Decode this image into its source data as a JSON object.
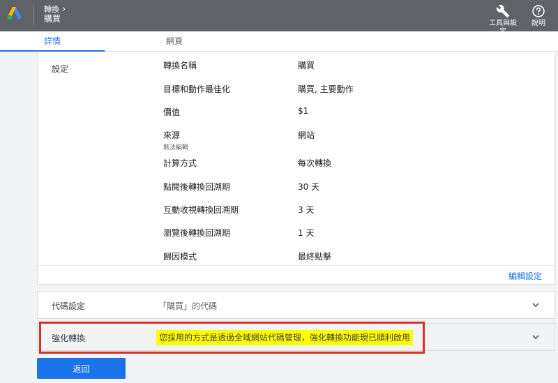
{
  "header": {
    "breadcrumb_parent": "轉換",
    "title": "購買",
    "tools_label": "工具與設定",
    "help_label": "說明",
    "colors": {
      "bar": "#5f6368",
      "logo_blue": "#4285f4",
      "logo_yellow": "#fbbc04",
      "logo_green": "#34a853"
    }
  },
  "tabs": [
    {
      "label": "詳情",
      "active": true
    },
    {
      "label": "網頁",
      "active": false
    }
  ],
  "settings": {
    "section_label": "設定",
    "rows": [
      {
        "label": "轉換名稱",
        "sub": "",
        "value": "購買"
      },
      {
        "label": "目標和動作最佳化",
        "sub": "",
        "value": "購買, 主要動作"
      },
      {
        "label": "價值",
        "sub": "",
        "value": "$1"
      },
      {
        "label": "來源",
        "sub": "無法編輯",
        "value": "網站"
      },
      {
        "label": "計算方式",
        "sub": "",
        "value": "每次轉換"
      },
      {
        "label": "點閱後轉換回溯期",
        "sub": "",
        "value": "30 天"
      },
      {
        "label": "互動收視轉換回溯期",
        "sub": "",
        "value": "3 天"
      },
      {
        "label": "瀏覽後轉換回溯期",
        "sub": "",
        "value": "1 天"
      },
      {
        "label": "歸因模式",
        "sub": "",
        "value": "最終點擊"
      }
    ],
    "edit_label": "編輯設定"
  },
  "tag_setup": {
    "label": "代碼設定",
    "value": "「購買」的代碼",
    "icon": "chevron-down-icon"
  },
  "enhanced": {
    "label": "強化轉換",
    "message": "您採用的方式是透過全域網站代碼管理，強化轉換功能現已順利啟用",
    "icon": "chevron-down-icon",
    "highlight_color": "#ffff00",
    "annotation_color": "#d93025"
  },
  "back_button": {
    "label": "返回",
    "color": "#1a73e8"
  }
}
